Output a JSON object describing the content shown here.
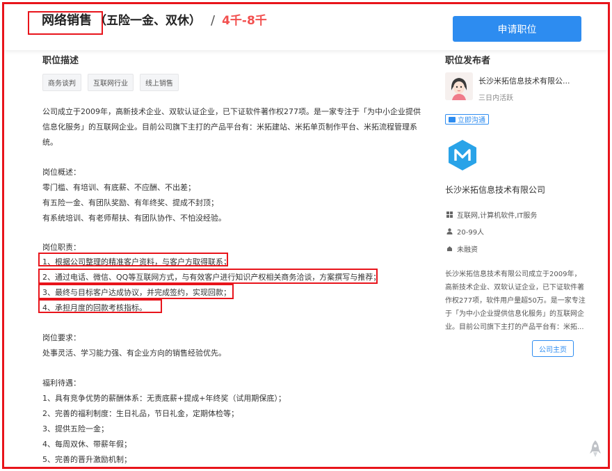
{
  "header": {
    "job_title": "网络销售",
    "job_subtitle": "（五险一金、双休）",
    "slash": "/",
    "salary": "4千-8千",
    "apply_button": "申请职位"
  },
  "job": {
    "section_title": "职位描述",
    "tags": [
      "商务谈判",
      "互联网行业",
      "线上销售"
    ],
    "lines": [
      "公司成立于2009年，高新技术企业、双软认证企业，已下证软件著作权277项。是一家专注于「为中小企业提供",
      "信息化服务」的互联网企业。目前公司旗下主打的产品平台有：米拓建站、米拓单页制作平台、米拓流程管理系",
      "统。",
      "岗位概述：",
      "零门槛、有培训、有底薪、不应酬、不出差；",
      "有五险一金、有团队奖励、有年终奖、提成不封顶；",
      "有系统培训、有老师帮扶、有团队协作、不怕没经验。",
      "岗位职责：",
      "1、根据公司整理的精准客户资料，与客户方取得联系；",
      "2、通过电话、微信、QQ等互联网方式，与有效客户进行知识产权相关商务洽谈，方案撰写与推荐；",
      "3、最终与目标客户达成协议，并完成签约，实现回款；",
      "4、承担月度的回款考核指标。",
      "岗位要求：",
      "处事灵活、学习能力强、有企业方向的销售经验优先。",
      "福利待遇：",
      "1、具有竞争优势的薪酬体系：无责底薪+提成+年终奖（试用期保底）；",
      "2、完善的福利制度：生日礼品，节日礼金，定期体检等；",
      "3、提供五险一金；",
      "4、每周双休、带薪年假；",
      "5、完善的晋升激励机制；"
    ]
  },
  "publisher": {
    "section_title": "职位发布者",
    "name": "长沙米拓信息技术有限公...",
    "active": "三日内活跃",
    "chat_button": "立即沟通"
  },
  "company": {
    "name": "长沙米拓信息技术有限公司",
    "industry": "互联网,计算机软件,IT服务",
    "size": "20-99人",
    "funding": "未融资",
    "intro": [
      "长沙米拓信息技术有限公司成立于2009年，",
      "高新技术企业、双软认证企业，已下证软件著",
      "作权277项，软件用户量超50万。是一家专注",
      "于「为中小企业提供信息化服务」的互联网企",
      "业。目前公司旗下主打的产品平台有：米拓..."
    ],
    "home_button": "公司主页"
  },
  "colors": {
    "accent": "#2d8cf0",
    "salary": "#f2504f",
    "annotation": "#e8141b",
    "logo": "#29a3e8"
  }
}
